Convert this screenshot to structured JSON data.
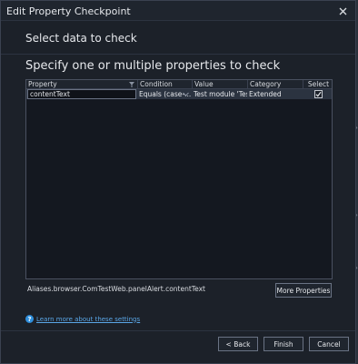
{
  "window": {
    "title": "Edit Property Checkpoint",
    "close_icon": "close-icon"
  },
  "page": {
    "step_title": "Select data to check",
    "subheading": "Specify one or multiple properties to check"
  },
  "grid": {
    "columns": [
      "Property",
      "Condition",
      "Value",
      "Category",
      "Select"
    ],
    "filter_icon": "filter-icon",
    "rows": [
      {
        "property": "contentText",
        "condition": "Equals (case-...",
        "value": "Test module 'Test...",
        "category": "Extended",
        "selected": true
      }
    ]
  },
  "object_path": "Aliases.browser.ComTestWeb.panelAlert.contentText",
  "buttons": {
    "more_properties": "More Properties",
    "back": "< Back",
    "finish": "Finish",
    "cancel": "Cancel"
  },
  "help": {
    "icon": "help-icon",
    "icon_glyph": "?",
    "link": "Learn more about these settings"
  },
  "colors": {
    "accent": "#2f8fdc",
    "link": "#5aa6e6",
    "background": "#1c2129",
    "selected_row": "#2b3340"
  }
}
